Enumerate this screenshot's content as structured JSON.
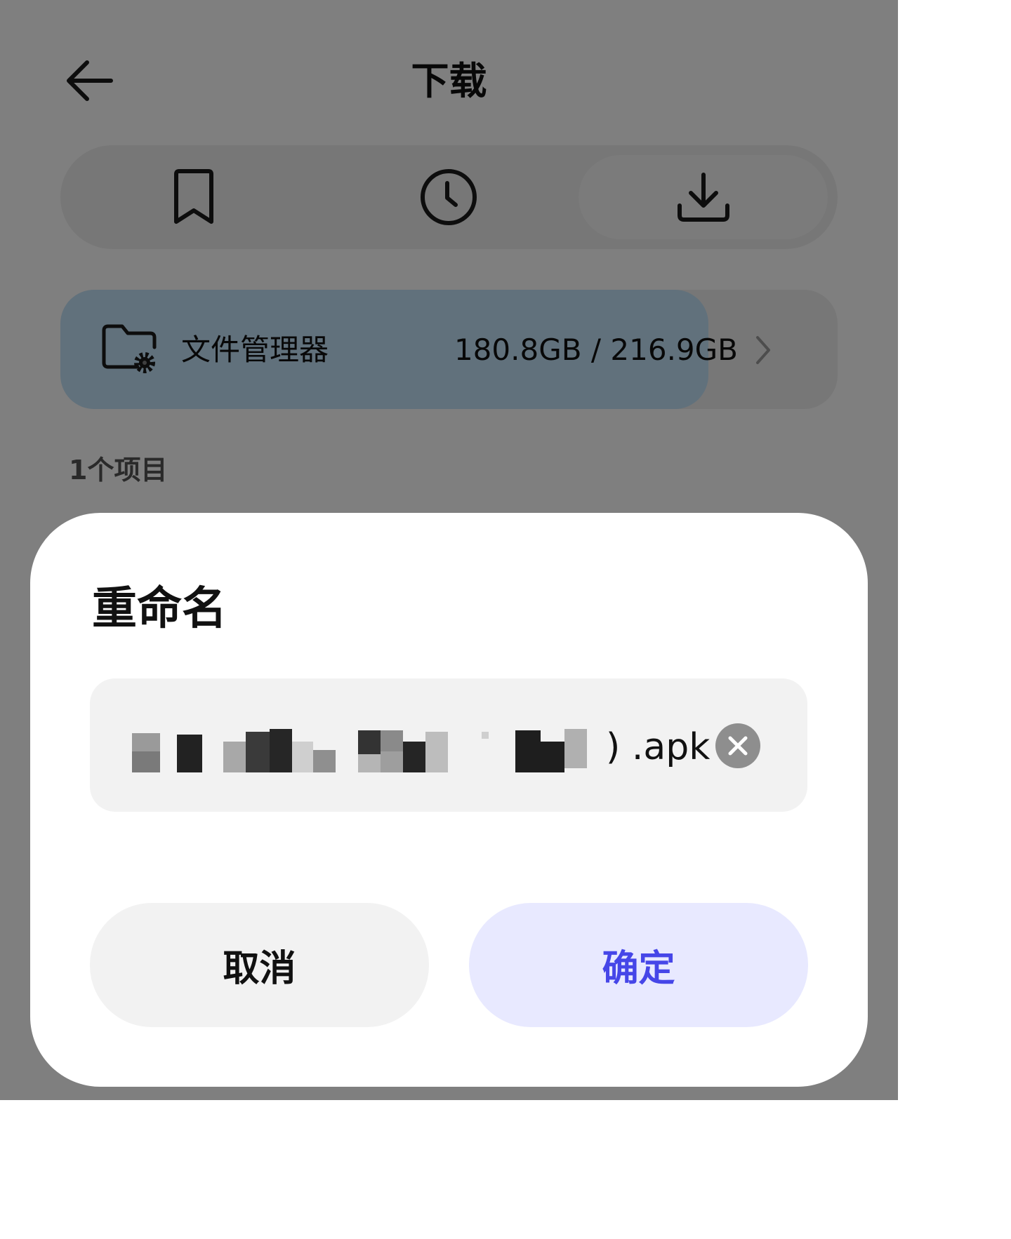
{
  "header": {
    "title": "下载",
    "back_icon": "arrow-left-icon"
  },
  "tabs": [
    {
      "icon": "bookmark-icon",
      "selected": false
    },
    {
      "icon": "clock-icon",
      "selected": false
    },
    {
      "icon": "download-icon",
      "selected": true
    }
  ],
  "storage": {
    "label": "文件管理器",
    "value": "180.8GB / 216.9GB",
    "used_fraction": 0.834,
    "icon": "folder-gear-icon",
    "fill_color": "#c2e2f8"
  },
  "list": {
    "count_label": "1个项目"
  },
  "dialog": {
    "title": "重命名",
    "filename_extension": ") .apk",
    "clear_icon": "clear-icon",
    "cancel_label": "取消",
    "confirm_label": "确定",
    "confirm_color": "#4646e8"
  }
}
